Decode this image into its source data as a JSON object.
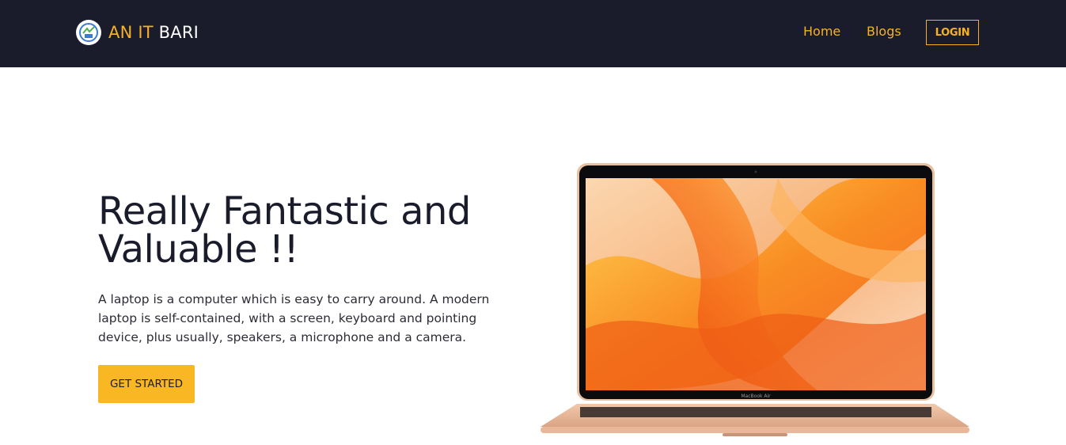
{
  "navbar": {
    "brand_accent": "AN IT",
    "brand_main": "BARI",
    "links": [
      {
        "label": "Home"
      },
      {
        "label": "Blogs"
      }
    ],
    "login_label": "LOGIN"
  },
  "hero": {
    "title": "Really Fantastic and Valuable !!",
    "description": "A laptop is a computer which is easy to carry around. A modern laptop is self-contained, with a screen, keyboard and pointing device, plus usually, speakers, a microphone and a camera.",
    "cta_label": "GET STARTED",
    "laptop_model": "MacBook Air"
  },
  "colors": {
    "navbar_bg": "#1b1c2b",
    "accent": "#f6b126",
    "cta_bg": "#f9b823",
    "heading": "#1b1c2b"
  },
  "icons": {
    "brand_logo": "logo-icon"
  }
}
